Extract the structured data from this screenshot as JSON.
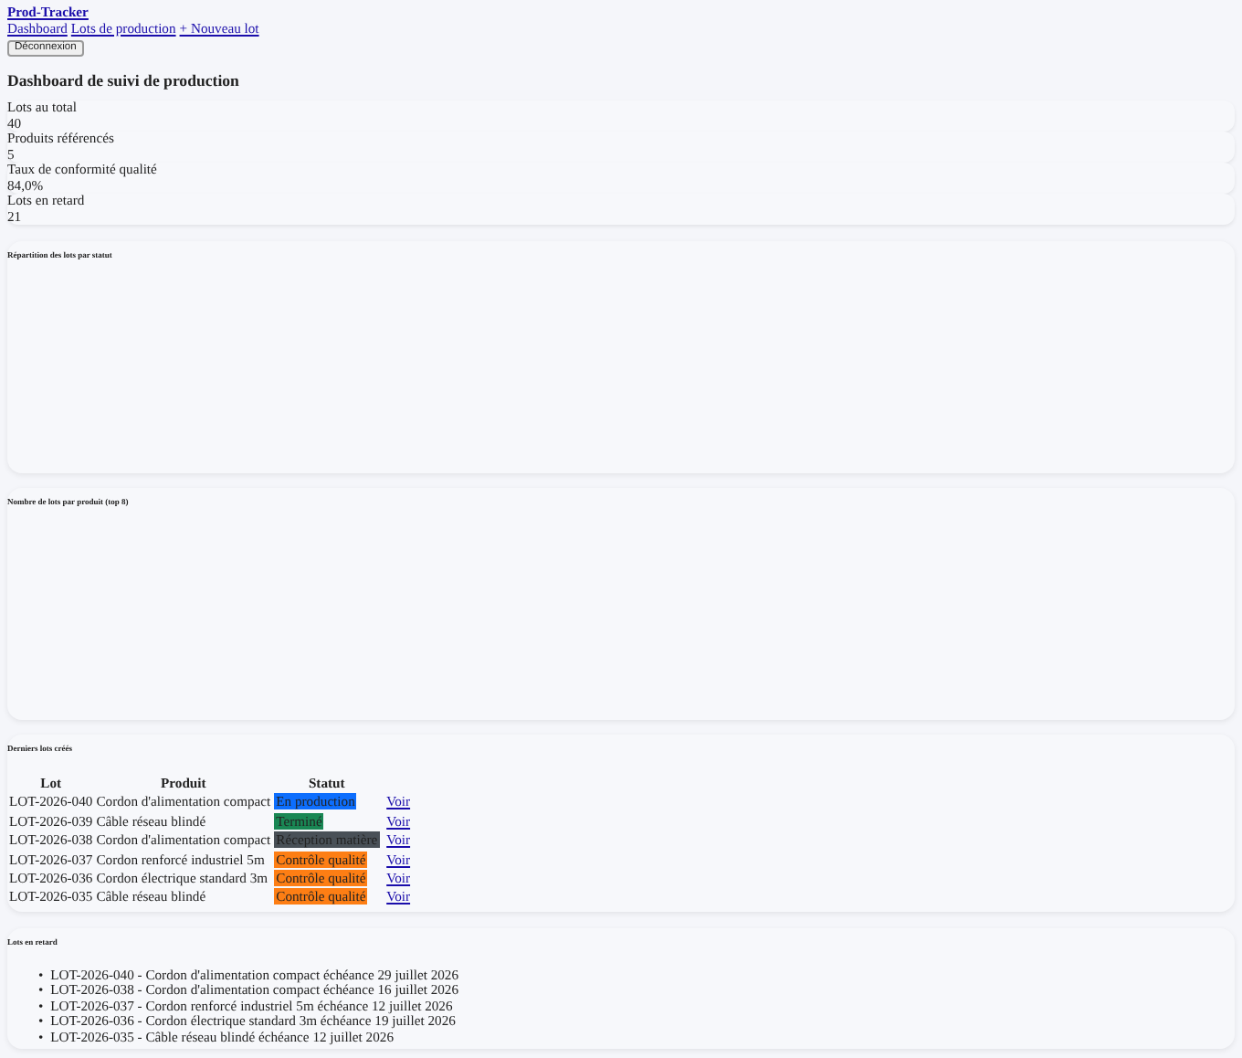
{
  "brand": "Prod-Tracker",
  "nav": [
    {
      "label": "Dashboard"
    },
    {
      "label": "Lots de production"
    },
    {
      "label": "+ Nouveau lot"
    }
  ],
  "logout_button": "Déconnexion",
  "heading": "Dashboard de suivi de production",
  "stats": [
    {
      "label": "Lots au total",
      "value": "40"
    },
    {
      "label": "Produits référencés",
      "value": "5"
    },
    {
      "label": "Taux de conformité qualité",
      "value": "84,0%"
    },
    {
      "label": "Lots en retard",
      "value": "21"
    }
  ],
  "charts": [
    {
      "title": "Répartition des lots par statut"
    },
    {
      "title": "Nombre de lots par produit (top 8)"
    }
  ],
  "recent_lots": {
    "title": "Derniers lots créés",
    "columns": [
      "Lot",
      "Produit",
      "Statut"
    ],
    "rows": [
      {
        "lot": "LOT-2026-040",
        "product": "Cordon d'alimentation compact",
        "status": "En production",
        "color": "#0d6efd",
        "link": "Voir"
      },
      {
        "lot": "LOT-2026-039",
        "product": "Câble réseau blindé",
        "status": "Terminé",
        "color": "#198754",
        "link": "Voir"
      },
      {
        "lot": "LOT-2026-038",
        "product": "Cordon d'alimentation compact",
        "status": "Réception matière",
        "color": "#495057",
        "link": "Voir"
      },
      {
        "lot": "LOT-2026-037",
        "product": "Cordon renforcé industriel 5m",
        "status": "Contrôle qualité",
        "color": "#fd7e14",
        "link": "Voir"
      },
      {
        "lot": "LOT-2026-036",
        "product": "Cordon électrique standard 3m",
        "status": "Contrôle qualité",
        "color": "#fd7e14",
        "link": "Voir"
      },
      {
        "lot": "LOT-2026-035",
        "product": "Câble réseau blindé",
        "status": "Contrôle qualité",
        "color": "#fd7e14",
        "link": "Voir"
      }
    ]
  },
  "late_lots": {
    "title": "Lots en retard",
    "marker": "•",
    "items": [
      "LOT-2026-040 - Cordon d'alimentation compact échéance 29 juillet 2026",
      "LOT-2026-038 - Cordon d'alimentation compact échéance 16 juillet 2026",
      "LOT-2026-037 - Cordon renforcé industriel 5m échéance 12 juillet 2026",
      "LOT-2026-036 - Cordon électrique standard 3m échéance 19 juillet 2026",
      "LOT-2026-035 - Câble réseau blindé échéance 12 juillet 2026"
    ]
  }
}
